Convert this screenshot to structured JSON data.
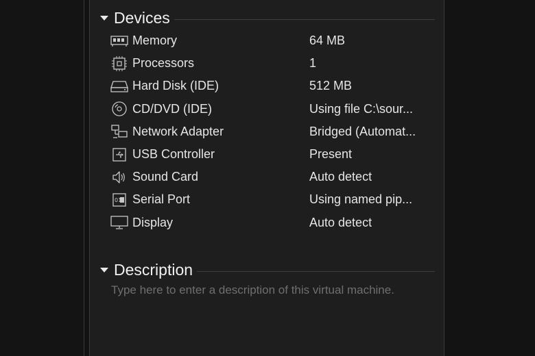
{
  "devices_section": {
    "title": "Devices",
    "items": [
      {
        "name": "Memory",
        "summary": "64 MB",
        "icon": "memory-icon"
      },
      {
        "name": "Processors",
        "summary": "1",
        "icon": "processor-icon"
      },
      {
        "name": "Hard Disk (IDE)",
        "summary": "512 MB",
        "icon": "hard-disk-icon"
      },
      {
        "name": "CD/DVD (IDE)",
        "summary": "Using file C:\\sour...",
        "icon": "cd-dvd-icon"
      },
      {
        "name": "Network Adapter",
        "summary": "Bridged (Automat...",
        "icon": "network-adapter-icon"
      },
      {
        "name": "USB Controller",
        "summary": "Present",
        "icon": "usb-controller-icon"
      },
      {
        "name": "Sound Card",
        "summary": "Auto detect",
        "icon": "sound-card-icon"
      },
      {
        "name": "Serial Port",
        "summary": "Using named pip...",
        "icon": "serial-port-icon"
      },
      {
        "name": "Display",
        "summary": "Auto detect",
        "icon": "display-icon"
      }
    ]
  },
  "description_section": {
    "title": "Description",
    "placeholder": "Type here to enter a description of this virtual machine."
  },
  "colors": {
    "background": "#1e1e1e",
    "text": "#e6e6e6",
    "placeholder_text": "#6f6f6f",
    "rule": "#404040"
  }
}
